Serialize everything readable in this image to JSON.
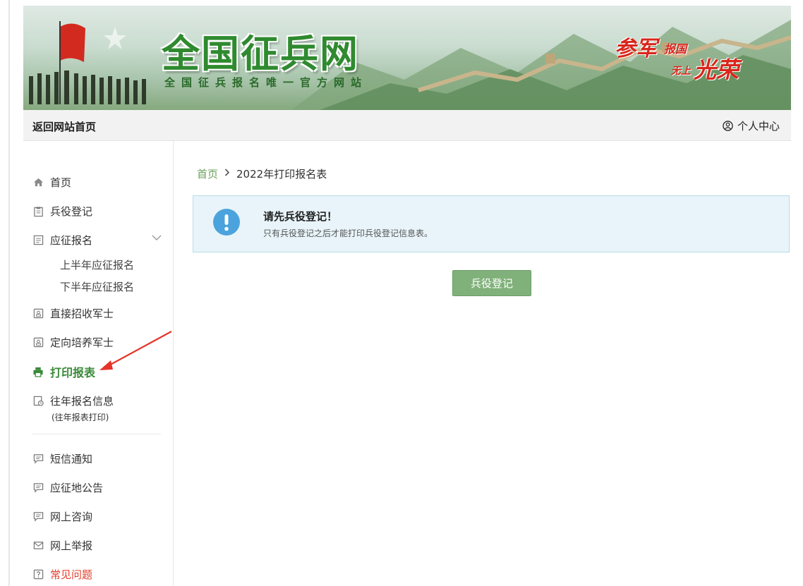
{
  "banner": {
    "site_title": "全国征兵网",
    "site_subtitle": "全国征兵报名唯一官方网站",
    "slogan": {
      "part1": "参军",
      "part2": "报国",
      "part3": "无上",
      "part4": "光荣"
    }
  },
  "topnav": {
    "home_link": "返回网站首页",
    "personal_center": "个人中心"
  },
  "sidebar": {
    "items": [
      {
        "label": "首页",
        "icon": "home-icon"
      },
      {
        "label": "兵役登记",
        "icon": "clipboard-icon"
      },
      {
        "label": "应征报名",
        "icon": "form-icon",
        "expanded_icon": "chevron-down-icon",
        "children": [
          "上半年应征报名",
          "下半年应征报名"
        ]
      },
      {
        "label": "直接招收军士",
        "icon": "id-card-icon"
      },
      {
        "label": "定向培养军士",
        "icon": "id-card-icon"
      },
      {
        "label": "打印报表",
        "icon": "printer-icon",
        "active": true
      },
      {
        "label": "往年报名信息",
        "note": "(往年报表打印)",
        "icon": "history-icon"
      },
      {
        "label": "短信通知",
        "icon": "message-icon"
      },
      {
        "label": "应征地公告",
        "icon": "message-icon"
      },
      {
        "label": "网上咨询",
        "icon": "message-icon"
      },
      {
        "label": "网上举报",
        "icon": "mail-icon"
      },
      {
        "label": "常见问题",
        "icon": "question-icon"
      }
    ]
  },
  "main": {
    "breadcrumb": {
      "home": "首页",
      "current": "2022年打印报名表"
    },
    "alert": {
      "title": "请先兵役登记！",
      "text": "只有兵役登记之后才能打印兵役登记信息表。"
    },
    "action_button": "兵役登记"
  },
  "colors": {
    "accent_green": "#80b17a",
    "active_green": "#3a8a3a",
    "alert_bg": "#e8f4f9",
    "alert_icon": "#4aa3dd",
    "warning_red": "#e43d2b",
    "annotation_arrow": "#e5332a"
  }
}
